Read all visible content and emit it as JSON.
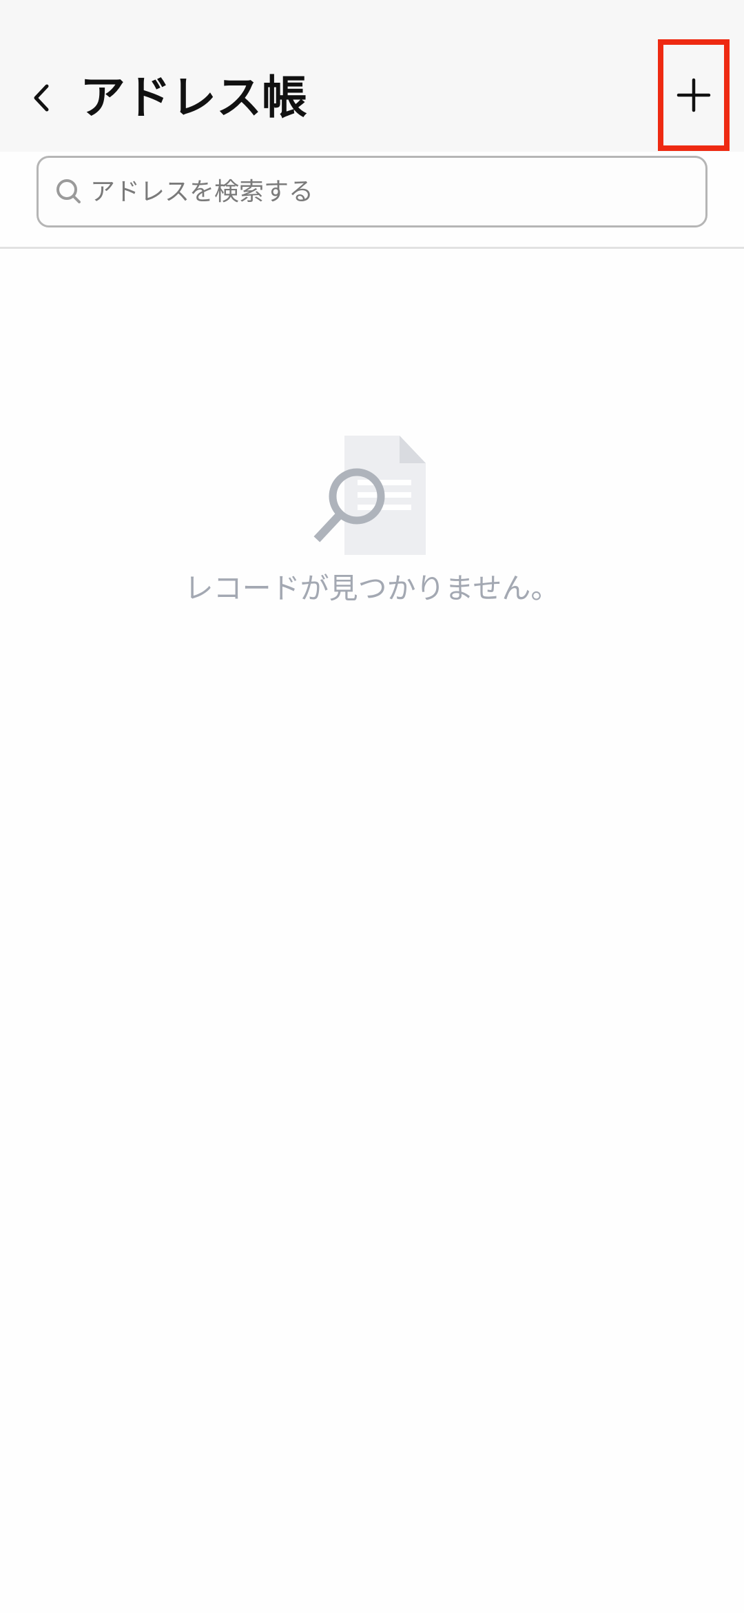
{
  "header": {
    "title": "アドレス帳",
    "back_icon": "chevron-left-icon",
    "add_icon": "plus-icon"
  },
  "search": {
    "placeholder": "アドレスを検索する",
    "value": "",
    "icon": "search-icon"
  },
  "empty_state": {
    "icon": "document-search-icon",
    "message": "レコードが見つかりません。"
  },
  "colors": {
    "highlight_border": "#ee2a12",
    "title_text": "#111111",
    "placeholder_text": "#7a7a7a",
    "empty_text": "#a3a8b2"
  }
}
